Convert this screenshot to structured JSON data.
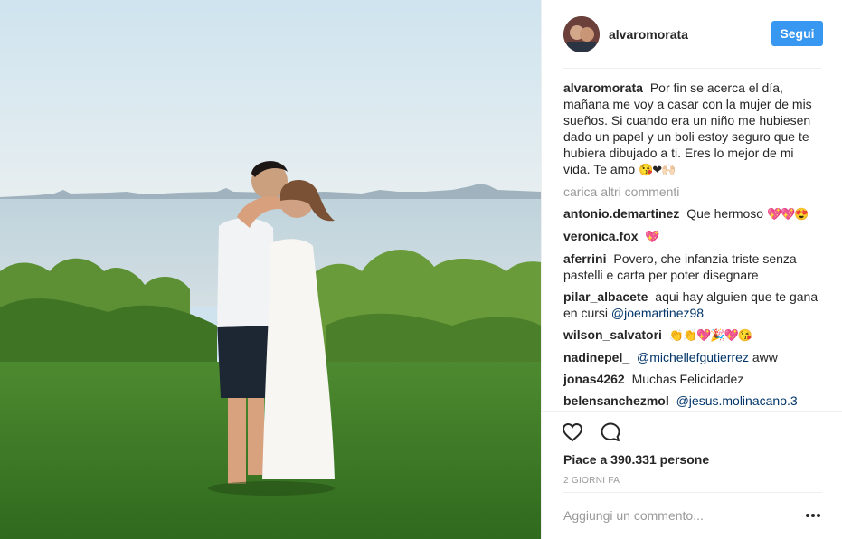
{
  "post": {
    "photo_alt": "",
    "author": {
      "username": "alvaromorata",
      "follow_label": "Segui"
    },
    "caption": {
      "author": "alvaromorata",
      "text": "Por fin se acerca el día, mañana me voy a casar con la mujer de mis sueños. Si cuando era un niño me hubiesen dado un papel y un boli estoy seguro que te hubiera dibujado a ti. Eres lo mejor de mi vida. Te amo",
      "emoji": "😘❤🙌🏻"
    },
    "load_more_label": "carica altri commenti",
    "comments": [
      {
        "author": "antonio.demartinez",
        "text": "Que hermoso",
        "emoji": "💖💖😍"
      },
      {
        "author": "veronica.fox",
        "text": "",
        "emoji": "💖"
      },
      {
        "author": "aferrini",
        "text": "Povero, che infanzia triste senza pastelli e carta per poter disegnare",
        "emoji": ""
      },
      {
        "author": "pilar_albacete",
        "text": "aqui hay alguien que te gana en cursi",
        "mention": "@joemartinez98",
        "emoji": ""
      },
      {
        "author": "wilson_salvatori",
        "text": "",
        "emoji": "👏👏💖🎉💖😘"
      },
      {
        "author": "nadinepel_",
        "mention": "@michellefgutierrez",
        "text": "aww",
        "emoji": ""
      },
      {
        "author": "jonas4262",
        "text": "Muchas Felicidadez",
        "emoji": ""
      },
      {
        "author": "belensanchezmol",
        "mention": "@jesus.molinacano.3",
        "text": "",
        "emoji": ""
      }
    ],
    "likes_label": "Piace a 390.331 persone",
    "timestamp": "2 giorni fa",
    "add_comment_placeholder": "Aggiungi un commento...",
    "icons": {
      "like": "heart-icon",
      "comment": "comment-bubble-icon",
      "more": "more-options-icon"
    },
    "colors": {
      "follow_button": "#3897f0",
      "mention": "#003569",
      "muted": "#999999"
    }
  }
}
